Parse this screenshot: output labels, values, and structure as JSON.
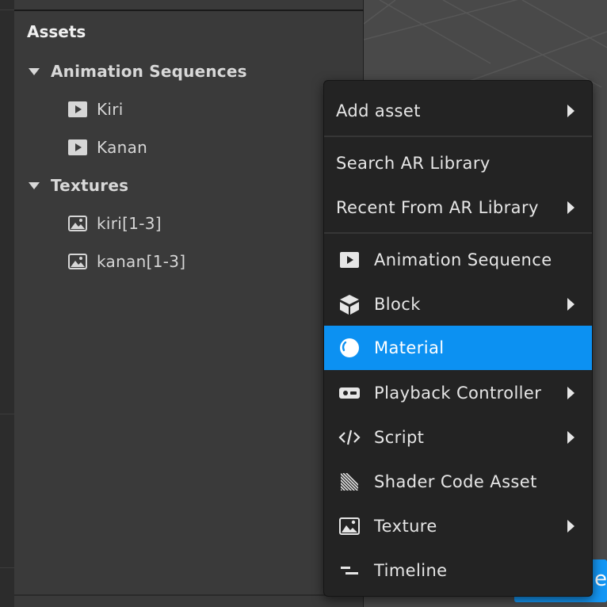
{
  "assets_panel": {
    "title": "Assets",
    "groups": [
      {
        "label": "Animation Sequences",
        "items": [
          {
            "label": "Kiri",
            "icon": "play-icon"
          },
          {
            "label": "Kanan",
            "icon": "play-icon"
          }
        ]
      },
      {
        "label": "Textures",
        "items": [
          {
            "label": "kiri[1-3]",
            "icon": "image-icon"
          },
          {
            "label": "kanan[1-3]",
            "icon": "image-icon"
          }
        ]
      }
    ]
  },
  "viewport": {
    "partial_button_text": "e",
    "accent_color": "#1497f5"
  },
  "context_menu": {
    "add_asset": {
      "label": "Add asset",
      "submenu": true
    },
    "search_ar": {
      "label": "Search AR Library"
    },
    "recent_ar": {
      "label": "Recent From AR Library",
      "submenu": true
    },
    "items": [
      {
        "label": "Animation Sequence",
        "icon": "play-icon",
        "submenu": false
      },
      {
        "label": "Block",
        "icon": "cube-icon",
        "submenu": true
      },
      {
        "label": "Material",
        "icon": "material-sphere-icon",
        "submenu": false,
        "selected": true
      },
      {
        "label": "Playback Controller",
        "icon": "controller-icon",
        "submenu": true
      },
      {
        "label": "Script",
        "icon": "code-icon",
        "submenu": true
      },
      {
        "label": "Shader Code Asset",
        "icon": "shader-hatch-icon",
        "submenu": false
      },
      {
        "label": "Texture",
        "icon": "image-icon",
        "submenu": true
      },
      {
        "label": "Timeline",
        "icon": "timeline-icon",
        "submenu": false
      }
    ],
    "selected_color": "#0c91f2"
  }
}
